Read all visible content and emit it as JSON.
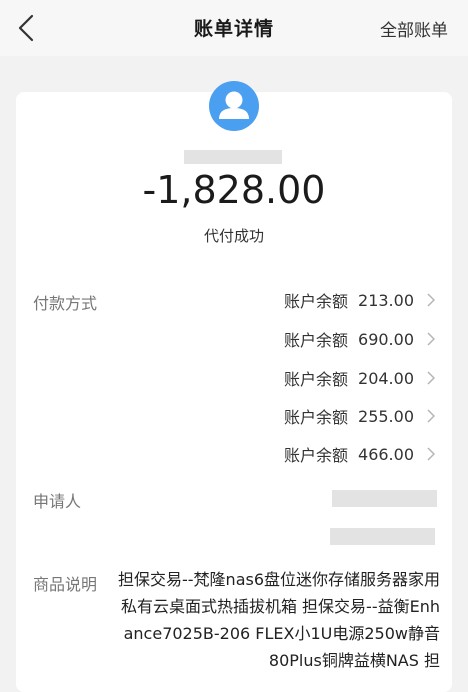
{
  "nav": {
    "title": "账单详情",
    "right_link": "全部账单"
  },
  "bill": {
    "amount": "-1,828.00",
    "status": "代付成功"
  },
  "payment": {
    "label": "付款方式",
    "items": [
      {
        "method": "账户余额",
        "amount": "213.00"
      },
      {
        "method": "账户余额",
        "amount": "690.00"
      },
      {
        "method": "账户余额",
        "amount": "204.00"
      },
      {
        "method": "账户余额",
        "amount": "255.00"
      },
      {
        "method": "账户余额",
        "amount": "466.00"
      }
    ]
  },
  "applicant": {
    "label": "申请人"
  },
  "product": {
    "label": "商品说明",
    "description": "担保交易--梵隆nas6盘位迷你存储服务器家用私有云桌面式热插拔机箱 担保交易--益衡Enhance7025B-206 FLEX小1U电源250w静音80Plus铜牌益横NAS 担"
  },
  "colors": {
    "accent": "#4b9ff0",
    "background": "#f2f2f2",
    "card": "#ffffff",
    "redaction": "#e3e3e3"
  }
}
